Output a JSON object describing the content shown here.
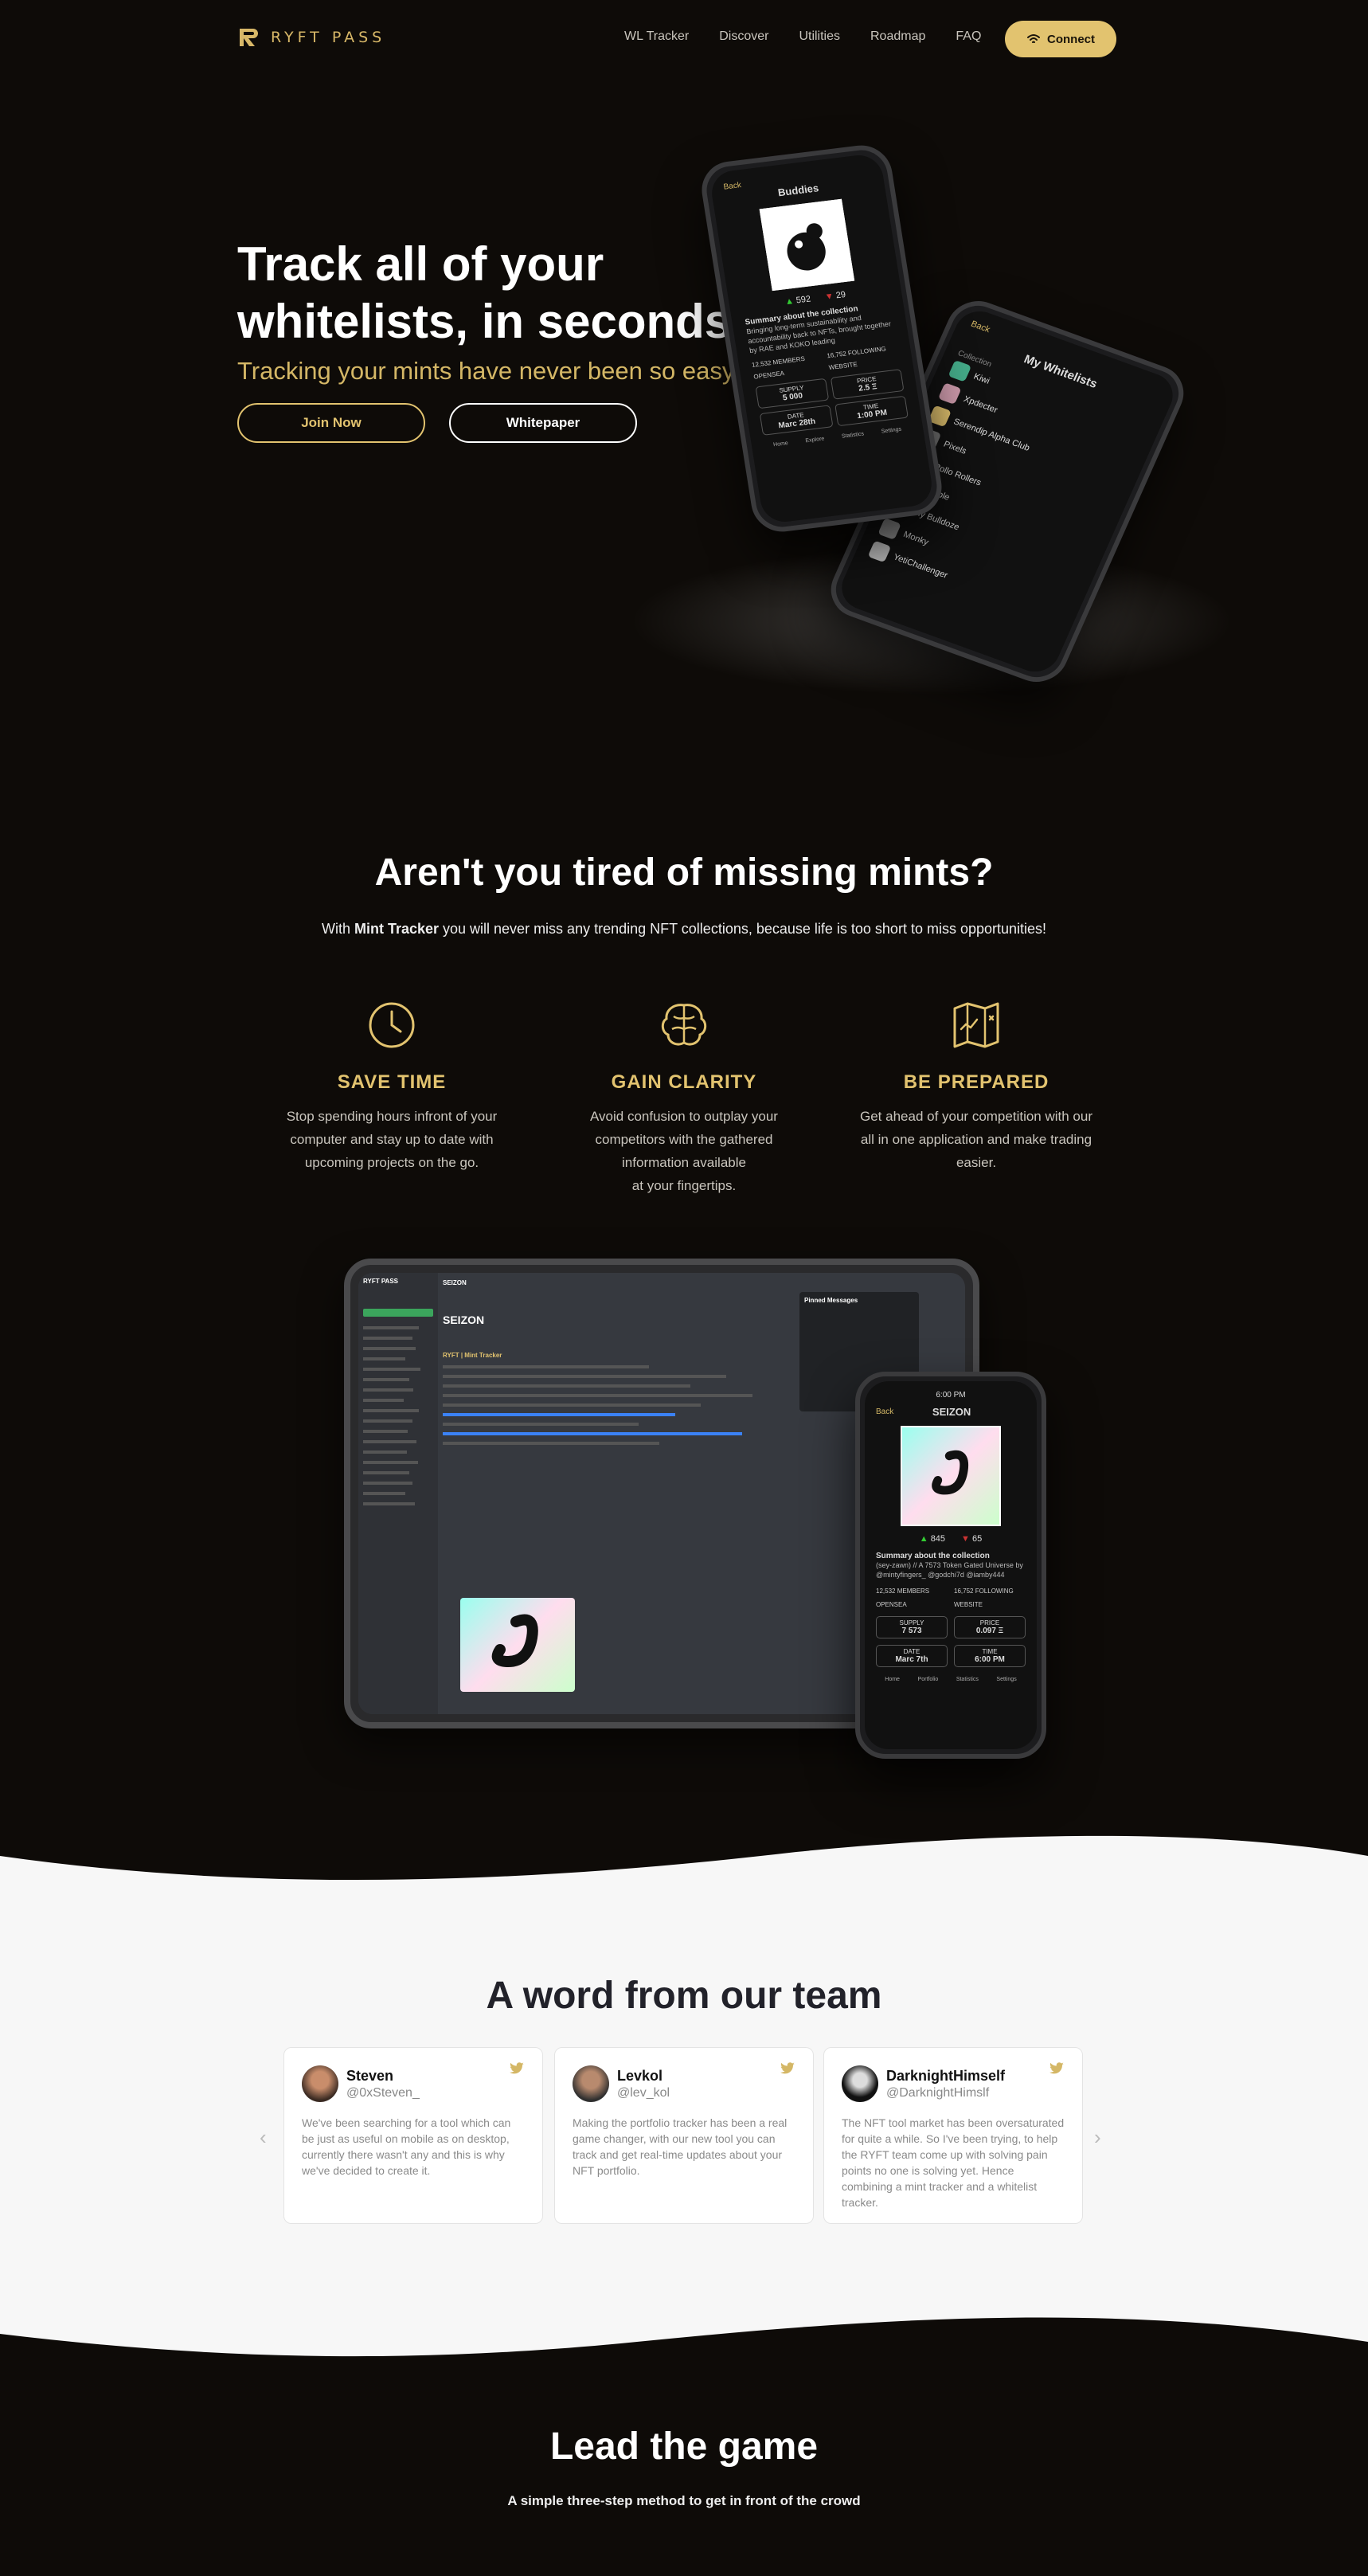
{
  "brand": {
    "name": "RYFT PASS",
    "gold": "#e2c36f",
    "background": "#0e0b08"
  },
  "nav": {
    "links": [
      "WL Tracker",
      "Discover",
      "Utilities",
      "Roadmap",
      "FAQ"
    ],
    "connect_label": "Connect"
  },
  "hero": {
    "title_line1": "Track all of your",
    "title_line2": "whitelists, in seconds.",
    "subtitle": "Tracking your mints have never been so easy!",
    "join_label": "Join Now",
    "whitepaper_label": "Whitepaper",
    "phone1": {
      "back": "Back",
      "title": "Buddies",
      "up": "592",
      "down": "29",
      "summary_title": "Summary about the collection",
      "summary": "Bringing long-term sustainability and accountability back to NFTs, brought together by RAE and KOKO leading",
      "members": "12,532 MEMBERS",
      "following": "16,752 FOLLOWING",
      "opensea": "OPENSEA",
      "website": "WEBSITE",
      "supply_label": "SUPPLY",
      "supply": "5 000",
      "price_label": "PRICE",
      "price": "2.5 Ξ",
      "date_label": "DATE",
      "date": "Marc 28th",
      "time_label": "TIME",
      "time": "1:00 PM",
      "tabs": [
        "Home",
        "Explore",
        "Statistics",
        "Settings"
      ]
    },
    "phone2": {
      "back": "Back",
      "title": "My Whitelists",
      "section": "Collection",
      "items": [
        "Kiwi",
        "Xpdecter",
        "Serendip Alpha Club",
        "Pixels",
        "Rollo Rollers",
        "Marble",
        "My Bulldoze",
        "Monky",
        "YetiChallenger"
      ]
    }
  },
  "section_mints": {
    "title": "Aren't you tired of missing mints?",
    "sub_pre": "With ",
    "sub_bold": "Mint Tracker",
    "sub_post": " you will never miss any trending NFT collections, because life is too short to miss opportunities!",
    "features": [
      {
        "icon": "clock-icon",
        "title": "SAVE TIME",
        "lines": [
          "Stop spending hours infront of your",
          "computer and stay up to date with",
          "upcoming projects on the go."
        ]
      },
      {
        "icon": "brain-icon",
        "title": "GAIN CLARITY",
        "lines": [
          "Avoid confusion to outplay your",
          "competitors with the gathered",
          "information available",
          "at your fingertips."
        ]
      },
      {
        "icon": "map-icon",
        "title": "BE PREPARED",
        "lines": [
          "Get ahead of your competition with our",
          "all in one application and make trading",
          "easier."
        ]
      }
    ]
  },
  "devices": {
    "server": "RYFT PASS",
    "channel": "SEIZON",
    "channel_title": "SEIZON",
    "pinned": "Pinned Messages",
    "tracker_name": "RYFT | Mint Tracker",
    "phone": {
      "time": "6:00 PM",
      "back": "Back",
      "title": "SEIZON",
      "up": "845",
      "down": "65",
      "summary_title": "Summary about the collection",
      "summary": "(sey-zawn) // A 7573 Token Gated Universe by @mintyfingers_ @godchi7d @iamby444",
      "members": "12,532 MEMBERS",
      "following": "16,752 FOLLOWING",
      "opensea": "OPENSEA",
      "website": "WEBSITE",
      "supply_label": "SUPPLY",
      "supply": "7 573",
      "price_label": "PRICE",
      "price": "0.097 Ξ",
      "date_label": "DATE",
      "date": "Marc 7th",
      "time_label": "TIME",
      "tabs": [
        "Home",
        "Portfolio",
        "Statistics",
        "Settings"
      ]
    }
  },
  "team": {
    "title": "A word from our team",
    "cards": [
      {
        "name": "Steven",
        "handle": "@0xSteven_",
        "text": "We've been searching for a tool which can be just as useful on mobile as on desktop, currently there wasn't any and this is why we've decided to create it."
      },
      {
        "name": "Levkol",
        "handle": "@lev_kol",
        "text": "Making the portfolio tracker has been a real game changer, with our new tool you can track and get real-time updates about your NFT portfolio."
      },
      {
        "name": "DarknightHimself",
        "handle": "@DarknightHimslf",
        "text": "The NFT tool market has been oversaturated for quite a while. So I've been trying, to help the RYFT team come up with solving pain points no one is solving yet. Hence combining a mint tracker and a whitelist tracker."
      }
    ],
    "prev": "‹",
    "next": "›"
  },
  "lead": {
    "title": "Lead the game",
    "subtitle": "A simple three-step method to get in front of the crowd"
  }
}
